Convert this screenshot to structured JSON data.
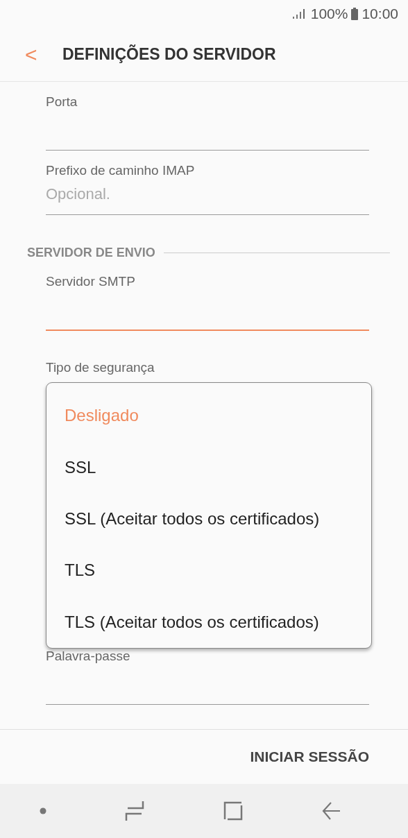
{
  "status_bar": {
    "battery": "100%",
    "time": "10:00"
  },
  "header": {
    "back": "<",
    "title": "DEFINIÇÕES DO SERVIDOR"
  },
  "incoming_fields": [
    {
      "label": "Porta",
      "focused": false
    },
    {
      "label": "Prefixo de caminho IMAP",
      "placeholder": "Opcional.",
      "focused": false
    }
  ],
  "outgoing_section": {
    "title": "SERVIDOR DE ENVIO"
  },
  "outgoing_fields": [
    {
      "label": "Servidor SMTP",
      "focused": true
    }
  ],
  "security": {
    "label": "Tipo de segurança",
    "options": [
      {
        "label": "Desligado",
        "selected": true
      },
      {
        "label": "SSL",
        "selected": false
      },
      {
        "label": "SSL (Aceitar todos os certificados)",
        "selected": false
      },
      {
        "label": "TLS",
        "selected": false
      },
      {
        "label": "TLS (Aceitar todos os certificados)",
        "selected": false
      }
    ]
  },
  "password_field": {
    "label": "Palavra-passe",
    "focused": false
  },
  "footer": {
    "button": "INICIAR SESSÃO"
  }
}
